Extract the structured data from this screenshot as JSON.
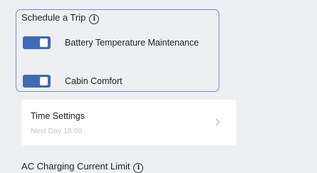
{
  "schedule_trip": {
    "title": "Schedule a Trip",
    "info_glyph": "i",
    "toggles": [
      {
        "label": "Battery Temperature Maintenance",
        "enabled": true
      },
      {
        "label": "Cabin Comfort",
        "enabled": true
      }
    ]
  },
  "time_settings": {
    "title": "Time Settings",
    "value": "Next Day 18:00"
  },
  "ac_charging": {
    "title": "AC Charging Current Limit",
    "info_glyph": "i"
  },
  "colors": {
    "accent": "#3e6ab8",
    "panel_border": "#6f8fd0",
    "background": "#eeeff1",
    "card": "#ffffff",
    "muted_text": "#c2c4c8"
  }
}
